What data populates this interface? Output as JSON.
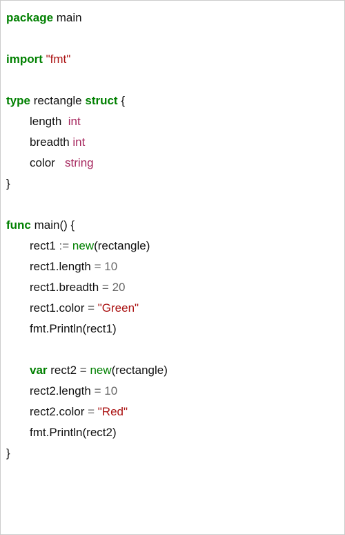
{
  "lines": {
    "l1_kw": "package",
    "l1_id": " main",
    "l3_kw": "import",
    "l3_sp": " ",
    "l3_str": "\"fmt\"",
    "l5_kw1": "type",
    "l5_id": " rectangle ",
    "l5_kw2": "struct",
    "l5_brace": " {",
    "l6_id": "length  ",
    "l6_typ": "int",
    "l7_id": "breadth ",
    "l7_typ": "int",
    "l8_id": "color   ",
    "l8_typ": "string",
    "l9_brace": "}",
    "l11_kw": "func",
    "l11_rest": " main() {",
    "l12_id1": "rect1 ",
    "l12_op": ":=",
    "l12_sp": " ",
    "l12_new": "new",
    "l12_rest": "(rectangle)",
    "l13_id": "rect1.length ",
    "l13_op": "=",
    "l13_sp": " ",
    "l13_num": "10",
    "l14_id": "rect1.breadth ",
    "l14_op": "=",
    "l14_sp": " ",
    "l14_num": "20",
    "l15_id": "rect1.color ",
    "l15_op": "=",
    "l15_sp": " ",
    "l15_str": "\"Green\"",
    "l16_txt": "fmt.Println(rect1)",
    "l18_kw": "var",
    "l18_id": " rect2 ",
    "l18_op": "=",
    "l18_sp": " ",
    "l18_new": "new",
    "l18_rest": "(rectangle)",
    "l19_id": "rect2.length ",
    "l19_op": "=",
    "l19_sp": " ",
    "l19_num": "10",
    "l20_id": "rect2.color ",
    "l20_op": "=",
    "l20_sp": " ",
    "l20_str": "\"Red\"",
    "l21_txt": "fmt.Println(rect2)",
    "l22_brace": "}"
  }
}
